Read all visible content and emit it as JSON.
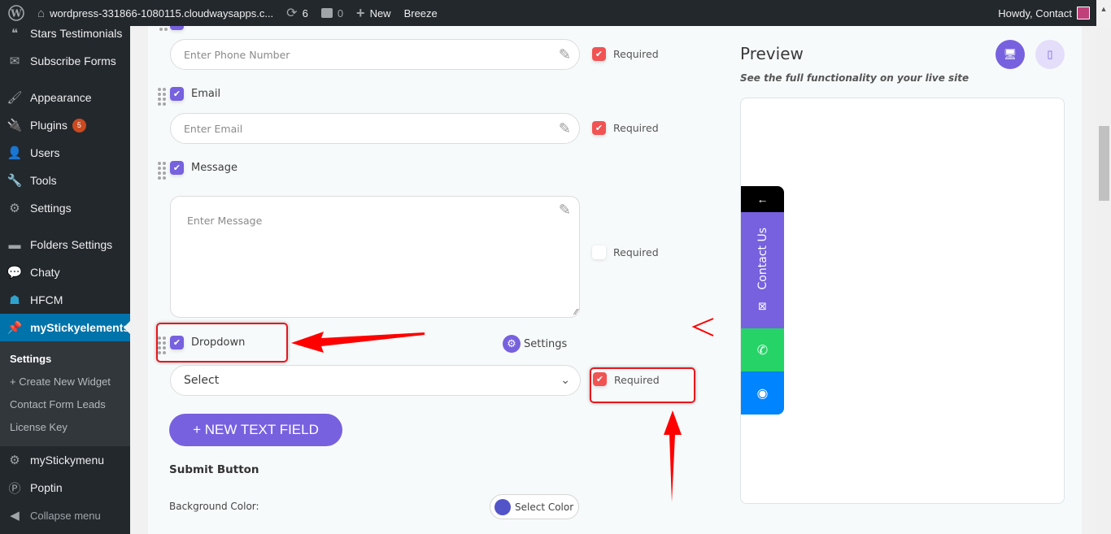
{
  "adminbar": {
    "site": "wordpress-331866-1080115.cloudwaysapps.c...",
    "updates": "6",
    "comments": "0",
    "new": "New",
    "breeze": "Breeze",
    "howdy": "Howdy, Contact"
  },
  "sidebar": {
    "items": [
      {
        "label": "Stars Testimonials",
        "icon": "quote-icon"
      },
      {
        "label": "Subscribe Forms",
        "icon": "envelope-icon"
      },
      {
        "label": "Appearance",
        "icon": "paintbrush-icon"
      },
      {
        "label": "Plugins",
        "icon": "plugin-icon",
        "badge": "5"
      },
      {
        "label": "Users",
        "icon": "user-icon"
      },
      {
        "label": "Tools",
        "icon": "wrench-icon"
      },
      {
        "label": "Settings",
        "icon": "settings-sliders-icon"
      },
      {
        "label": "Folders Settings",
        "icon": "folder-icon"
      },
      {
        "label": "Chaty",
        "icon": "chat-icon"
      },
      {
        "label": "HFCM",
        "icon": "robot-icon"
      },
      {
        "label": "myStickyelements",
        "icon": "pin-icon"
      },
      {
        "label": "myStickymenu",
        "icon": "gear-icon"
      },
      {
        "label": "Poptin",
        "icon": "poptin-icon"
      },
      {
        "label": "Collapse menu",
        "icon": "collapse-icon"
      }
    ],
    "submenu": [
      "Settings",
      "+ Create New Widget",
      "Contact Form Leads",
      "License Key"
    ]
  },
  "form": {
    "phone_placeholder": "Enter Phone Number",
    "email_label": "Email",
    "email_placeholder": "Enter Email",
    "message_label": "Message",
    "message_placeholder": "Enter Message",
    "dropdown_label": "Dropdown",
    "dropdown_value": "Select",
    "settings_label": "Settings",
    "required_label": "Required",
    "phone_required": true,
    "email_required": true,
    "message_required": false,
    "dropdown_required": true,
    "new_field_button": "+ NEW TEXT FIELD",
    "submit_section": "Submit Button",
    "bg_color_label": "Background Color:",
    "select_color": "Select Color",
    "bg_color_value": "#5354c7"
  },
  "preview": {
    "title": "Preview",
    "subtitle": "See the full functionality on your live site",
    "contact_label": "Contact Us",
    "back_arrow": "←"
  },
  "colors": {
    "accent": "#7761df",
    "required_red": "#f15353",
    "whatsapp": "#26d367",
    "messenger": "#0084ff",
    "wp_active": "#0073aa",
    "annotation": "#e8161c"
  }
}
